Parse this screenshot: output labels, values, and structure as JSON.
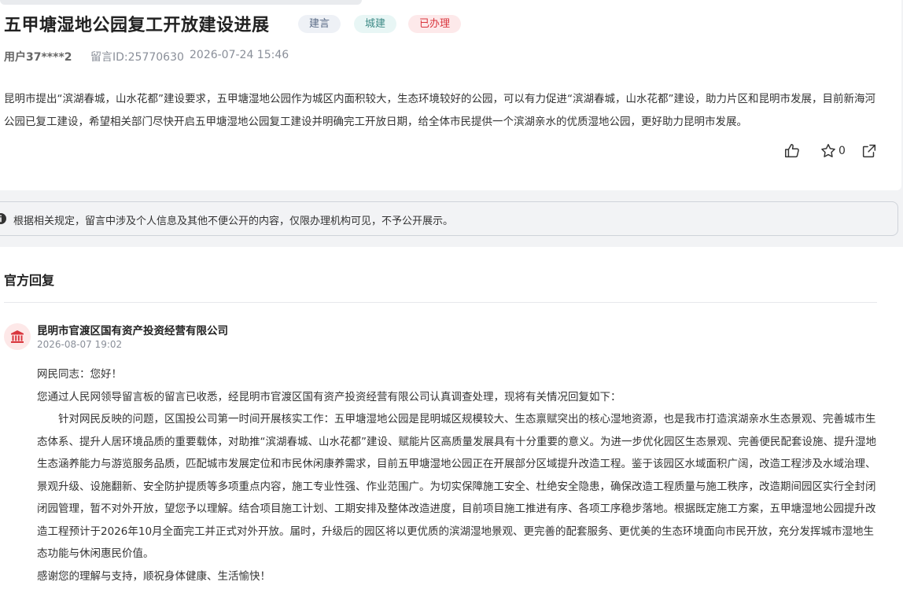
{
  "message": {
    "title": "五甲塘湿地公园复工开放建设进展",
    "tags": [
      "建言",
      "城建",
      "已办理"
    ],
    "user": "用户37****2",
    "message_id": "留言ID:25770630",
    "time": "2026-07-24 15:46",
    "content": "昆明市提出“滨湖春城，山水花都”建设要求，五甲塘湿地公园作为城区内面积较大，生态环境较好的公园，可以有力促进“滨湖春城，山水花都”建设，助力片区和昆明市发展，目前新海河公园已复工建设，希望相关部门尽快开启五甲塘湿地公园复工建设并明确完工开放日期，给全体市民提供一个滨湖亲水的优质湿地公园，更好助力昆明市发展。",
    "favorite_count": "0"
  },
  "notice": {
    "text": "根据相关规定，留言中涉及个人信息及其他不便公开的内容，仅限办理机构可见，不予公开展示。"
  },
  "reply": {
    "heading": "官方回复",
    "org_name": "昆明市官渡区国有资产投资经营有限公司",
    "time": "2026-08-07 19:02",
    "greeting": "网民同志：您好！",
    "intro": "您通过人民网领导留言板的留言已收悉，经昆明市官渡区国有资产投资经营有限公司认真调查处理，现将有关情况回复如下：",
    "body": "针对网民反映的问题，区国投公司第一时间开展核实工作：五甲塘湿地公园是昆明城区规模较大、生态禀赋突出的核心湿地资源，也是我市打造滨湖亲水生态景观、完善城市生态体系、提升人居环境品质的重要载体，对助推“滨湖春城、山水花都”建设、赋能片区高质量发展具有十分重要的意义。为进一步优化园区生态景观、完善便民配套设施、提升湿地生态涵养能力与游览服务品质，匹配城市发展定位和市民休闲康养需求，目前五甲塘湿地公园正在开展部分区域提升改造工程。鉴于该园区水域面积广阔，改造工程涉及水域治理、景观升级、设施翻新、安全防护提质等多项重点内容，施工专业性强、作业范围广。为切实保障施工安全、杜绝安全隐患，确保改造工程质量与施工秩序，改造期间园区实行全封闭闭园管理，暂不对外开放，望您予以理解。结合项目施工计划、工期安排及整体改造进度，目前项目施工推进有序、各项工序稳步落地。根据既定施工方案，五甲塘湿地公园提升改造工程预计于2026年10月全面完工并正式对外开放。届时，升级后的园区将以更优质的滨湖湿地景观、更完善的配套服务、更优美的生态环境面向市民开放，充分发挥城市湿地生态功能与休闲惠民价值。",
    "closing": "感谢您的理解与支持，顺祝身体健康、生活愉快！"
  },
  "colors": {
    "tag_suggest": "#5a6b86",
    "tag_urban": "#3d8a86",
    "tag_done": "#d9363e",
    "org_icon": "#d9363e"
  }
}
